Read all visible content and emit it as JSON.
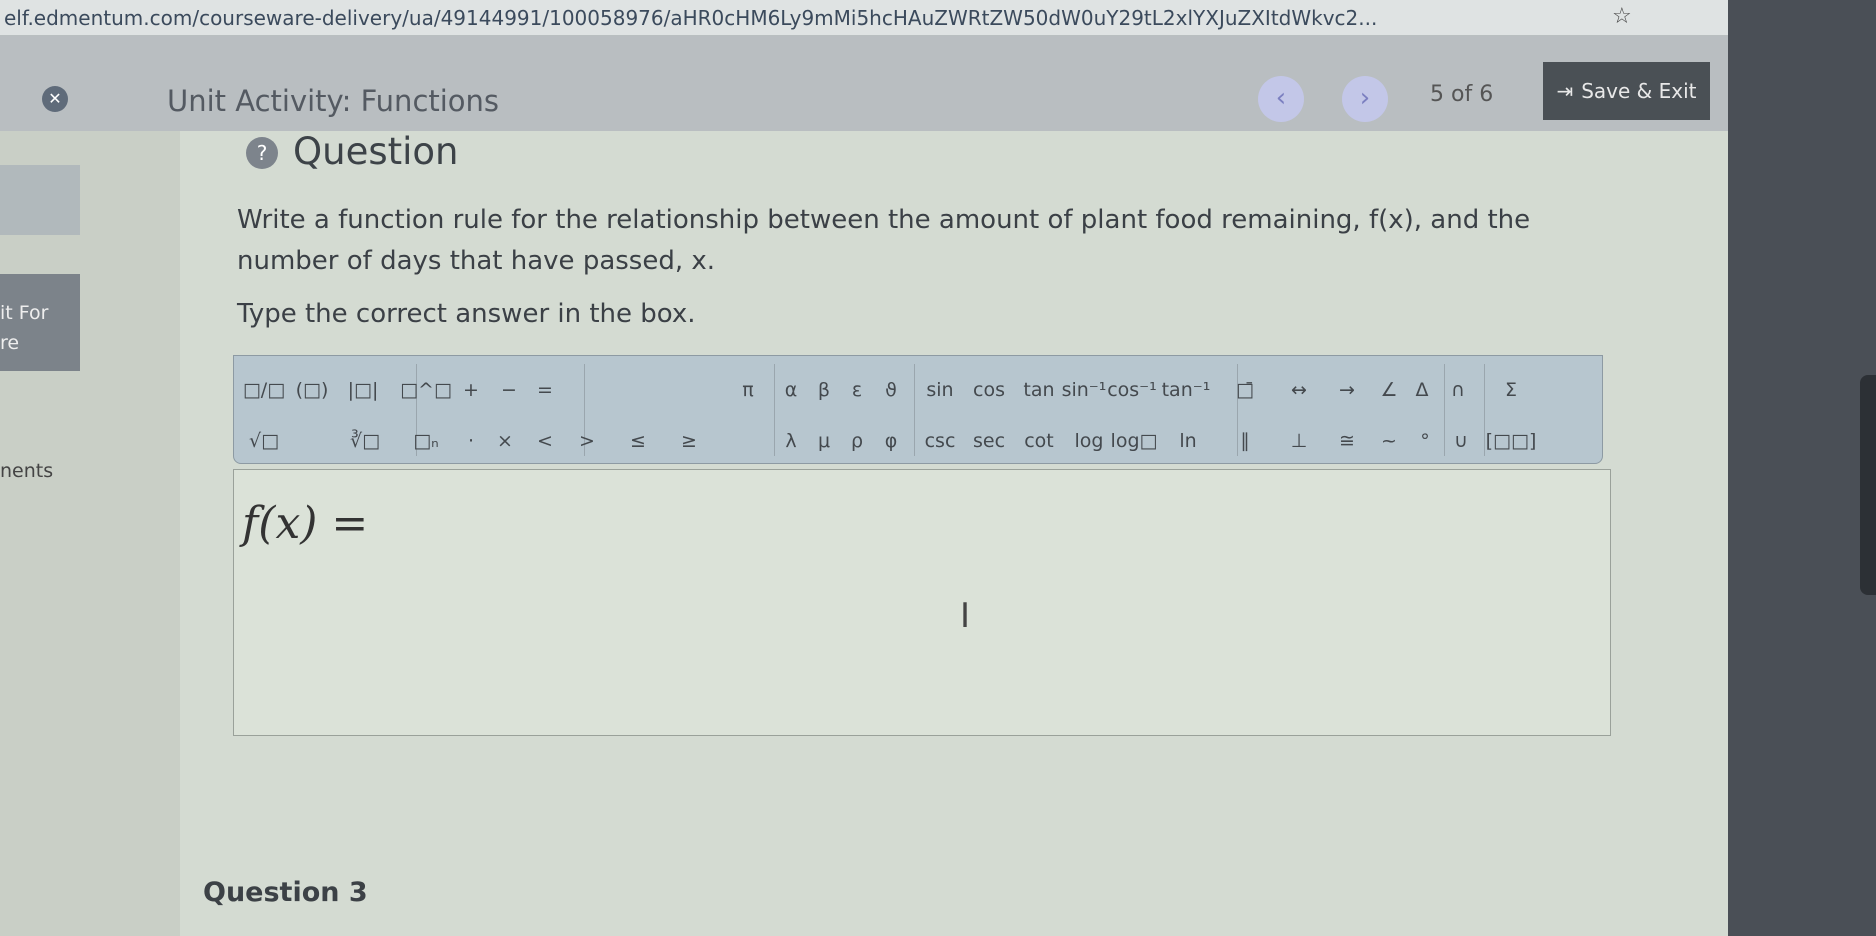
{
  "browser": {
    "url": "elf.edmentum.com/courseware-delivery/ua/49144991/100058976/aHR0cHM6Ly9mMi5hcHAuZWRtZW50dW0uY29tL2xlYXJuZXItdWkvc2..."
  },
  "header": {
    "title": "Unit Activity: Functions",
    "pager": "5 of 6",
    "save_label": "Save & Exit",
    "prev_icon": "chevron-left",
    "next_icon": "chevron-right"
  },
  "sidebar": {
    "panel_lines": [
      "it For",
      "re"
    ],
    "item": "nents"
  },
  "question": {
    "heading": "Question",
    "prompt_line1": "Write a function rule for the relationship between the amount of plant food remaining, f(x), and the",
    "prompt_line2": "number of days that have passed, x.",
    "instruction": "Type the correct answer in the box."
  },
  "toolbar": {
    "row1": [
      "□/□",
      "(□)",
      "|□|",
      "□^□",
      "+",
      "−",
      "=",
      "π",
      "α",
      "β",
      "ε",
      "ϑ",
      "sin",
      "cos",
      "tan",
      "sin⁻¹",
      "cos⁻¹",
      "tan⁻¹",
      "□̄",
      "↔",
      "→",
      "∠",
      "Δ",
      "∩",
      "Σ"
    ],
    "row2": [
      "√□",
      "∛□",
      "□ₙ",
      "·",
      "×",
      "<",
      ">",
      "≤",
      "≥",
      "λ",
      "μ",
      "ρ",
      "φ",
      "csc",
      "sec",
      "cot",
      "log",
      "log□",
      "ln",
      "∥",
      "⊥",
      "≅",
      "~",
      "°",
      "∪",
      "[□□]"
    ]
  },
  "answer": {
    "prefix": "f(x) =",
    "value": ""
  },
  "next_question": "Question 3"
}
